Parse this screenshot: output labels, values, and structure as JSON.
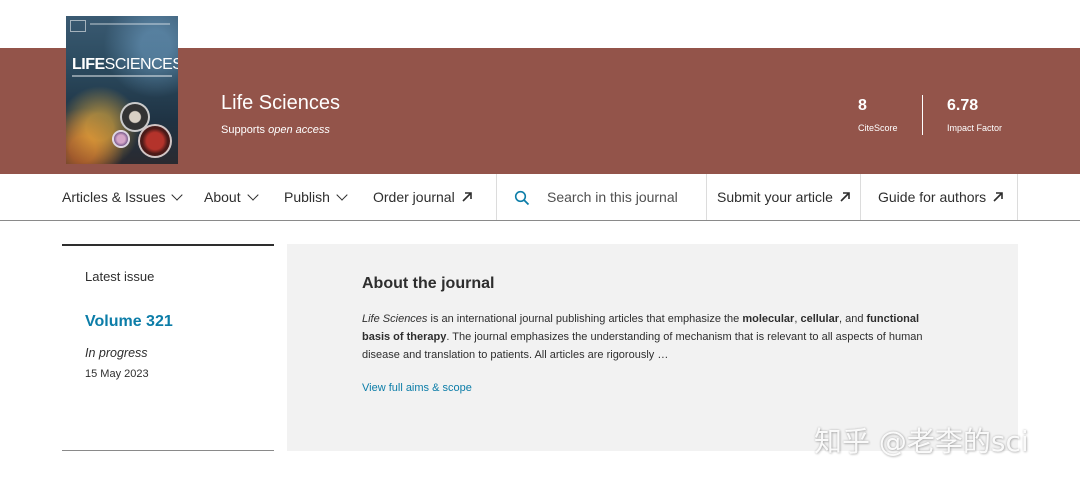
{
  "banner": {
    "cover": {
      "title_bold": "LIFE",
      "title_rest": "SCIENCES"
    },
    "journal_title": "Life Sciences",
    "oa_prefix": "Supports ",
    "oa_em": "open access",
    "metrics": [
      {
        "value": "8",
        "label": "CiteScore"
      },
      {
        "value": "6.78",
        "label": "Impact Factor"
      }
    ],
    "colors": {
      "banner": "#93544a",
      "link": "#0c7da8"
    }
  },
  "nav": {
    "articles_issues": "Articles & Issues",
    "about": "About",
    "publish": "Publish",
    "order_journal": "Order journal",
    "search_placeholder": "Search in this journal",
    "submit_article": "Submit your article",
    "guide_authors": "Guide for authors"
  },
  "latest_issue": {
    "label": "Latest issue",
    "volume": "Volume 321",
    "status": "In progress",
    "date": "15 May 2023"
  },
  "about": {
    "title": "About the journal",
    "t1": "Life Sciences",
    "t2": " is an international journal publishing articles that emphasize the ",
    "t3": "molecular",
    "t4": ", ",
    "t5": "cellular",
    "t6": ", and ",
    "t7": "functional basis of therapy",
    "t8": ". The journal emphasizes the understanding of mechanism that is relevant to all aspects of human disease and translation to patients. All articles are rigorously …",
    "view_scope": "View full aims & scope"
  },
  "watermark": "知乎 @老李的sci"
}
